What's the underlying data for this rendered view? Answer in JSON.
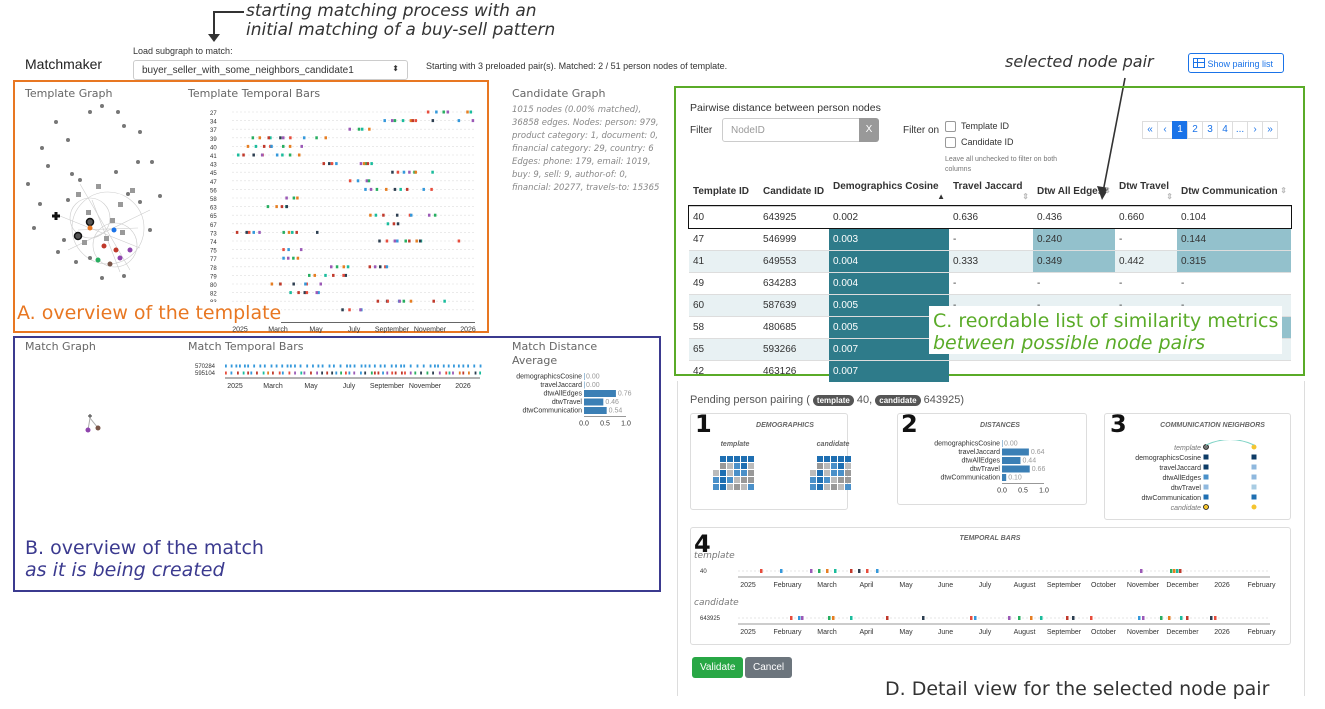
{
  "top_annotation": {
    "line1": "starting matching process with an",
    "line2": "initial matching of a buy-sell pattern"
  },
  "app_title": "Matchmaker",
  "load_label": "Load subgraph to match:",
  "subgraph_select": "buyer_seller_with_some_neighbors_candidate1",
  "status": "Starting with 3 preloaded pair(s). Matched: 2 / 51 person nodes of template.",
  "selected_pair_annotation": "selected node pair",
  "show_pairing_button": "Show pairing list",
  "template_panel": {
    "graph_title": "Template Graph",
    "bars_title": "Template Temporal Bars",
    "row_labels": [
      "27",
      "34",
      "37",
      "39",
      "40",
      "41",
      "43",
      "45",
      "47",
      "56",
      "58",
      "63",
      "65",
      "67",
      "73",
      "74",
      "75",
      "77",
      "78",
      "79",
      "80",
      "82",
      "83",
      "84"
    ],
    "axis": [
      "2025",
      "March",
      "May",
      "July",
      "September",
      "November",
      "2026"
    ],
    "annotation": "A. overview of the template"
  },
  "candidate_graph": {
    "title": "Candidate Graph",
    "text": "1015 nodes (0.00% matched), 36858 edges. Nodes: person: 979, product category: 1, document: 0, financial category: 29, country: 6 Edges: phone: 179, email: 1019, buy: 9, sell: 9, author-of: 0, financial: 20277, travels-to: 15365"
  },
  "match_panel": {
    "graph_title": "Match Graph",
    "bars_title": "Match Temporal Bars",
    "row_labels": [
      "570284",
      "595104"
    ],
    "axis": [
      "2025",
      "March",
      "May",
      "July",
      "September",
      "November",
      "2026"
    ],
    "distance_title_1": "Match Distance",
    "distance_title_2": "Average",
    "distance_metrics": [
      {
        "name": "demographicsCosine",
        "value": 0.0
      },
      {
        "name": "travelJaccard",
        "value": 0.0
      },
      {
        "name": "dtwAllEdges",
        "value": 0.76
      },
      {
        "name": "dtwTravel",
        "value": 0.46
      },
      {
        "name": "dtwCommunication",
        "value": 0.54
      }
    ],
    "distance_axis": [
      "0.0",
      "0.5",
      "1.0"
    ],
    "annotation_line1": "B. overview of the match",
    "annotation_line2": "as it is being created"
  },
  "pairwise": {
    "title": "Pairwise distance between person nodes",
    "filter_label": "Filter",
    "filter_placeholder": "NodeID",
    "clear_button": "X",
    "filter_on_label": "Filter on",
    "check_template": "Template ID",
    "check_candidate": "Candidate ID",
    "hint": "Leave all unchecked to filter on both columns",
    "pagination": [
      "«",
      "‹",
      "1",
      "2",
      "3",
      "4",
      "...",
      "›",
      "»"
    ],
    "columns": [
      "Template ID",
      "Candidate ID",
      "Demographics Cosine",
      "Travel Jaccard",
      "Dtw All Edges",
      "Dtw Travel",
      "Dtw Communication"
    ],
    "rows": [
      [
        "40",
        "643925",
        "0.002",
        "0.636",
        "0.436",
        "0.660",
        "0.104"
      ],
      [
        "47",
        "546999",
        "0.003",
        "-",
        "0.240",
        "-",
        "0.144"
      ],
      [
        "41",
        "649553",
        "0.004",
        "0.333",
        "0.349",
        "0.442",
        "0.315"
      ],
      [
        "49",
        "634283",
        "0.004",
        "-",
        "-",
        "-",
        "-"
      ],
      [
        "60",
        "587639",
        "0.005",
        "-",
        "-",
        "-",
        "-"
      ],
      [
        "58",
        "480685",
        "0.005",
        "-",
        "0.265",
        "-",
        "0.266"
      ],
      [
        "65",
        "593266",
        "0.007",
        "",
        "",
        "",
        ""
      ],
      [
        "42",
        "463126",
        "0.007",
        "",
        "",
        "",
        ""
      ]
    ],
    "annotation_line1": "C. reordable list of similarity metrics",
    "annotation_line2": "between possible node pairs"
  },
  "pending": {
    "title_prefix": "Pending person pairing (",
    "template_badge": "template",
    "template_id": "40,",
    "candidate_badge": "candidate",
    "candidate_id": "643925)",
    "card1": {
      "num": "1",
      "title": "DEMOGRAPHICS",
      "left": "template",
      "right": "candidate"
    },
    "card2": {
      "num": "2",
      "title": "DISTANCES",
      "metrics": [
        {
          "name": "demographicsCosine",
          "value": 0.0,
          "label": "0.00"
        },
        {
          "name": "travelJaccard",
          "value": 0.64,
          "label": "0.64"
        },
        {
          "name": "dtwAllEdges",
          "value": 0.44,
          "label": "0.44"
        },
        {
          "name": "dtwTravel",
          "value": 0.66,
          "label": "0.66"
        },
        {
          "name": "dtwCommunication",
          "value": 0.1,
          "label": "0.10"
        }
      ],
      "axis": [
        "0.0",
        "0.5",
        "1.0"
      ]
    },
    "card3": {
      "num": "3",
      "title": "COMMUNICATION NEIGHBORS",
      "rows": [
        "template",
        "demographicsCosine",
        "travelJaccard",
        "dtwAllEdges",
        "dtwTravel",
        "dtwCommunication",
        "candidate"
      ]
    },
    "card4": {
      "num": "4",
      "title": "TEMPORAL BARS",
      "template_label": "template",
      "template_row": "40",
      "candidate_label": "candidate",
      "candidate_row": "643925",
      "axis": [
        "2025",
        "February",
        "March",
        "April",
        "May",
        "June",
        "July",
        "August",
        "September",
        "October",
        "November",
        "December",
        "2026",
        "February"
      ]
    },
    "validate": "Validate",
    "cancel": "Cancel",
    "annotation": "D. Detail view for the selected node pair"
  },
  "colors": {
    "orange": "#e87722",
    "blue": "#3b3a8f",
    "green": "#5aab28",
    "teal": "#2e7b8a",
    "lteal": "#93c1cc"
  }
}
